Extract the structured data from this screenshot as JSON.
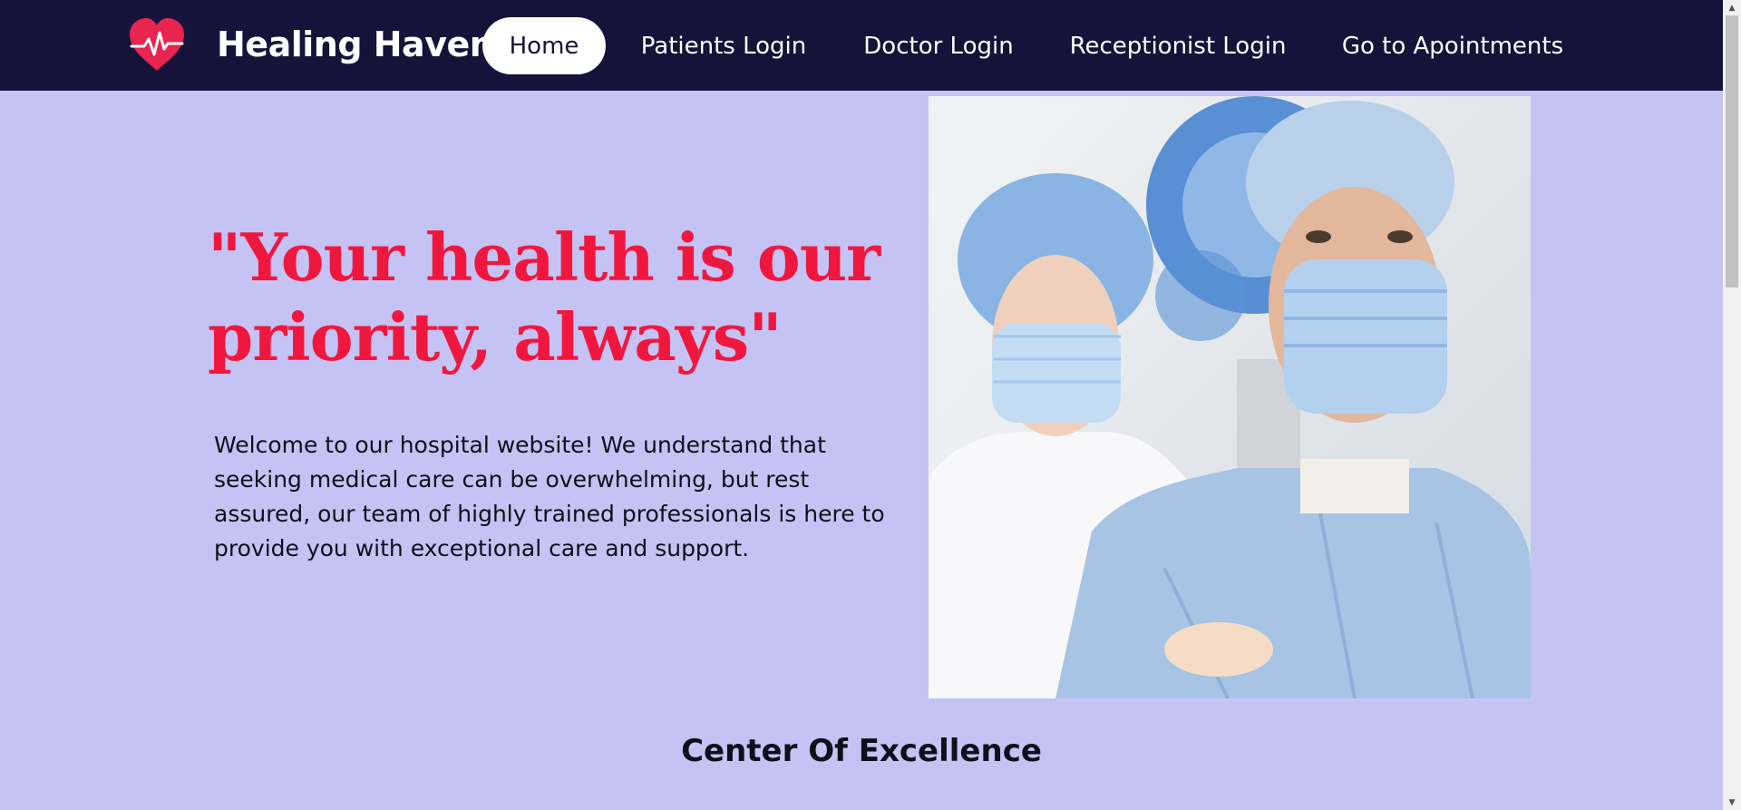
{
  "nav": {
    "brand": "Healing Haven",
    "links": [
      {
        "label": "Home",
        "active": true
      },
      {
        "label": "Patients Login"
      },
      {
        "label": "Doctor Login"
      },
      {
        "label": "Receptionist Login"
      },
      {
        "label": "Go to Apointments"
      }
    ]
  },
  "hero": {
    "quote": "\"Your health is our priority, always\"",
    "intro": "Welcome to our hospital website! We understand that seeking medical care can be overwhelming, but rest assured, our team of highly trained professionals is here to provide you with exceptional care and support.",
    "image_icon": "surgeons-photo"
  },
  "section": {
    "title": "Center Of Excellence"
  },
  "icons": {
    "logo": "heart-pulse-icon"
  },
  "colors": {
    "navbar": "#15133a",
    "page_background": "#c5c3f4",
    "accent": "#f0173f",
    "logo_heart": "#e8244f"
  }
}
